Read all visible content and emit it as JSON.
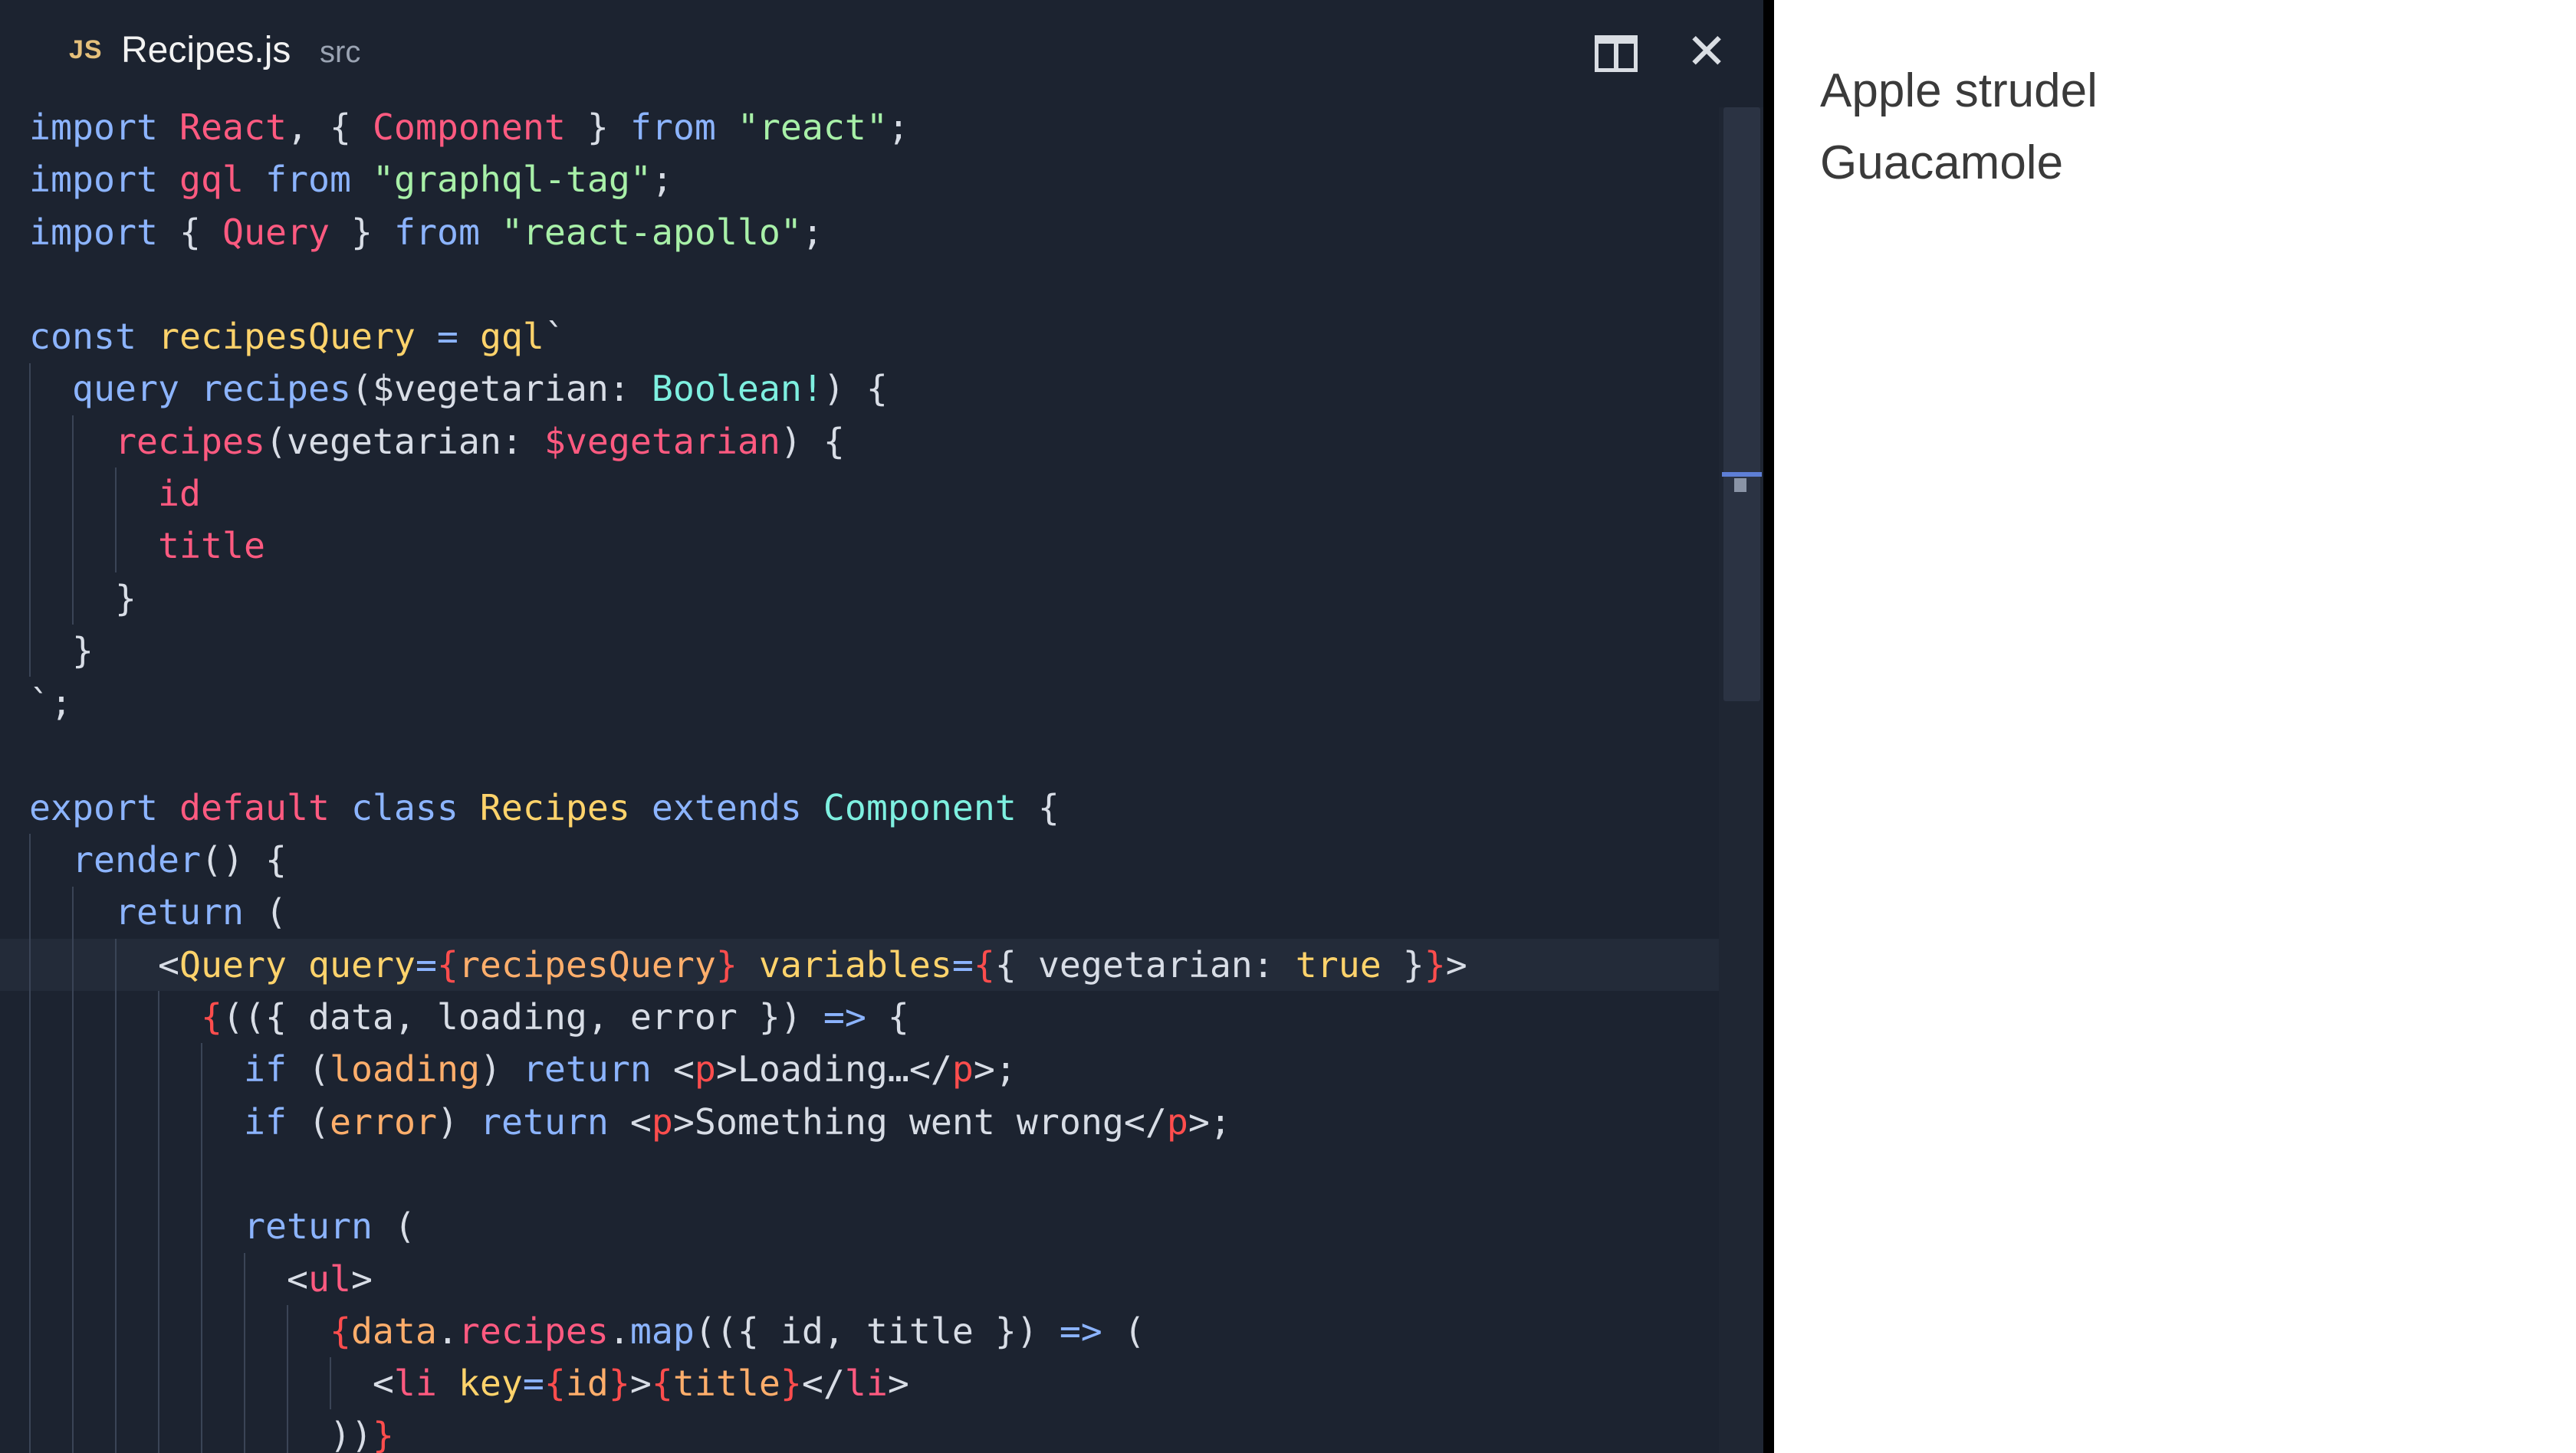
{
  "editor": {
    "tab": {
      "lang_badge": "JS",
      "filename": "Recipes.js",
      "directory": "src"
    },
    "actions": {
      "split_icon": "split-editor-icon",
      "close_glyph": "✕"
    },
    "colors": {
      "background": "#1c2330",
      "keyword": "#8cb4ff",
      "name": "#ff5a80",
      "string": "#a8f0a8",
      "function": "#ffd36b",
      "type": "#7ef0e0"
    },
    "lines": [
      [
        [
          "kw",
          "import "
        ],
        [
          "pk",
          "React"
        ],
        [
          "pl",
          ", { "
        ],
        [
          "pk",
          "Component"
        ],
        [
          "pl",
          " } "
        ],
        [
          "kw",
          "from "
        ],
        [
          "st",
          "\"react\""
        ],
        [
          "pl",
          ";"
        ]
      ],
      [
        [
          "kw",
          "import "
        ],
        [
          "pk",
          "gql"
        ],
        [
          "kw",
          " from "
        ],
        [
          "st",
          "\"graphql-tag\""
        ],
        [
          "pl",
          ";"
        ]
      ],
      [
        [
          "kw",
          "import "
        ],
        [
          "pl",
          "{ "
        ],
        [
          "pk",
          "Query"
        ],
        [
          "pl",
          " } "
        ],
        [
          "kw",
          "from "
        ],
        [
          "st",
          "\"react-apollo\""
        ],
        [
          "pl",
          ";"
        ]
      ],
      [],
      [
        [
          "kw",
          "const "
        ],
        [
          "fn",
          "recipesQuery"
        ],
        [
          "kw",
          " = "
        ],
        [
          "fn",
          "gql"
        ],
        [
          "pl",
          "`"
        ]
      ],
      [
        [
          "pl",
          "  "
        ],
        [
          "kw",
          "query "
        ],
        [
          "kw",
          "recipes"
        ],
        [
          "pl",
          "($vegetarian: "
        ],
        [
          "ty",
          "Boolean!"
        ],
        [
          "pl",
          ") {"
        ]
      ],
      [
        [
          "pl",
          "    "
        ],
        [
          "pk",
          "recipes"
        ],
        [
          "pl",
          "(vegetarian: "
        ],
        [
          "pk",
          "$vegetarian"
        ],
        [
          "pl",
          ") {"
        ]
      ],
      [
        [
          "pl",
          "      "
        ],
        [
          "pk",
          "id"
        ]
      ],
      [
        [
          "pl",
          "      "
        ],
        [
          "pk",
          "title"
        ]
      ],
      [
        [
          "pl",
          "    }"
        ]
      ],
      [
        [
          "pl",
          "  }"
        ]
      ],
      [
        [
          "pl",
          "`;"
        ]
      ],
      [],
      [
        [
          "kw",
          "export "
        ],
        [
          "pk",
          "default "
        ],
        [
          "kw",
          "class "
        ],
        [
          "fn",
          "Recipes "
        ],
        [
          "kw",
          "extends "
        ],
        [
          "ty",
          "Component"
        ],
        [
          "pl",
          " {"
        ]
      ],
      [
        [
          "pl",
          "  "
        ],
        [
          "kw",
          "render"
        ],
        [
          "pl",
          "() {"
        ]
      ],
      [
        [
          "pl",
          "    "
        ],
        [
          "kw",
          "return"
        ],
        [
          "pl",
          " ("
        ]
      ],
      [
        [
          "pl",
          "      <"
        ],
        [
          "fn",
          "Query "
        ],
        [
          "fn",
          "query"
        ],
        [
          "kw",
          "="
        ],
        [
          "rd",
          "{"
        ],
        [
          "or",
          "recipesQuery"
        ],
        [
          "rd",
          "}"
        ],
        [
          "fn",
          " variables"
        ],
        [
          "kw",
          "="
        ],
        [
          "rd",
          "{"
        ],
        [
          "pl",
          "{ vegetarian: "
        ],
        [
          "fn",
          "true "
        ],
        [
          "pl",
          "}"
        ],
        [
          "rd",
          "}"
        ],
        [
          "pl",
          ">"
        ]
      ],
      [
        [
          "pl",
          "        "
        ],
        [
          "rd",
          "{"
        ],
        [
          "pl",
          "(({ data, loading, error }) "
        ],
        [
          "kw",
          "=>"
        ],
        [
          "pl",
          " {"
        ]
      ],
      [
        [
          "pl",
          "          "
        ],
        [
          "kw",
          "if "
        ],
        [
          "pl",
          "("
        ],
        [
          "or",
          "loading"
        ],
        [
          "pl",
          ") "
        ],
        [
          "kw",
          "return "
        ],
        [
          "pl",
          "<"
        ],
        [
          "rd",
          "p"
        ],
        [
          "pl",
          ">Loading…</"
        ],
        [
          "rd",
          "p"
        ],
        [
          "pl",
          ">;"
        ]
      ],
      [
        [
          "pl",
          "          "
        ],
        [
          "kw",
          "if "
        ],
        [
          "pl",
          "("
        ],
        [
          "or",
          "error"
        ],
        [
          "pl",
          ") "
        ],
        [
          "kw",
          "return "
        ],
        [
          "pl",
          "<"
        ],
        [
          "rd",
          "p"
        ],
        [
          "pl",
          ">Something went wrong</"
        ],
        [
          "rd",
          "p"
        ],
        [
          "pl",
          ">;"
        ]
      ],
      [],
      [
        [
          "pl",
          "          "
        ],
        [
          "kw",
          "return"
        ],
        [
          "pl",
          " ("
        ]
      ],
      [
        [
          "pl",
          "            <"
        ],
        [
          "pk",
          "ul"
        ],
        [
          "pl",
          ">"
        ]
      ],
      [
        [
          "pl",
          "              "
        ],
        [
          "rd",
          "{"
        ],
        [
          "or",
          "data"
        ],
        [
          "pl",
          "."
        ],
        [
          "pk",
          "recipes"
        ],
        [
          "pl",
          "."
        ],
        [
          "kw",
          "map"
        ],
        [
          "pl",
          "(({ id, title }) "
        ],
        [
          "kw",
          "=>"
        ],
        [
          "pl",
          " ("
        ]
      ],
      [
        [
          "pl",
          "                <"
        ],
        [
          "pk",
          "li "
        ],
        [
          "fn",
          "key"
        ],
        [
          "kw",
          "="
        ],
        [
          "rd",
          "{"
        ],
        [
          "or",
          "id"
        ],
        [
          "rd",
          "}"
        ],
        [
          "pl",
          ">"
        ],
        [
          "rd",
          "{"
        ],
        [
          "or",
          "title"
        ],
        [
          "rd",
          "}"
        ],
        [
          "pl",
          "</"
        ],
        [
          "pk",
          "li"
        ],
        [
          "pl",
          ">"
        ]
      ],
      [
        [
          "pl",
          "              ))"
        ],
        [
          "rd",
          "}"
        ]
      ]
    ]
  },
  "preview": {
    "items": [
      "Apple strudel",
      "Guacamole"
    ]
  }
}
